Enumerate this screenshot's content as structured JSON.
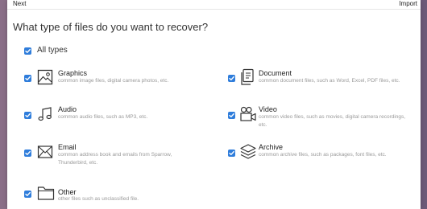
{
  "topbar": {
    "next_label": "Next",
    "import_label": "Import"
  },
  "heading": "What type of files do you want to recover?",
  "all_types": {
    "label": "All types",
    "checked": true
  },
  "file_types": {
    "graphics": {
      "title": "Graphics",
      "description": "common image files, digital camera photos, etc.",
      "icon": "image-icon",
      "checked": true
    },
    "document": {
      "title": "Document",
      "description": "common document files, such as Word, Excel, PDF files, etc.",
      "icon": "document-icon",
      "checked": true
    },
    "audio": {
      "title": "Audio",
      "description": "common audio files, such as MP3, etc.",
      "icon": "music-note-icon",
      "checked": true
    },
    "video": {
      "title": "Video",
      "description": "common video files, such as movies, digital camera recordings, etc.",
      "icon": "video-camera-icon",
      "checked": true
    },
    "email": {
      "title": "Email",
      "description": "common address book and emails from Sparrow, Thunderbird, etc.",
      "icon": "envelope-icon",
      "checked": true
    },
    "archive": {
      "title": "Archive",
      "description": "common archive files, such as packages, font files, etc.",
      "icon": "layers-icon",
      "checked": true
    },
    "other": {
      "title": "Other",
      "description": "other files such as unclassified file.",
      "icon": "folder-icon",
      "checked": true
    }
  },
  "colors": {
    "accent": "#2f7ddb",
    "text": "#333333",
    "muted": "#9a9a9a"
  }
}
